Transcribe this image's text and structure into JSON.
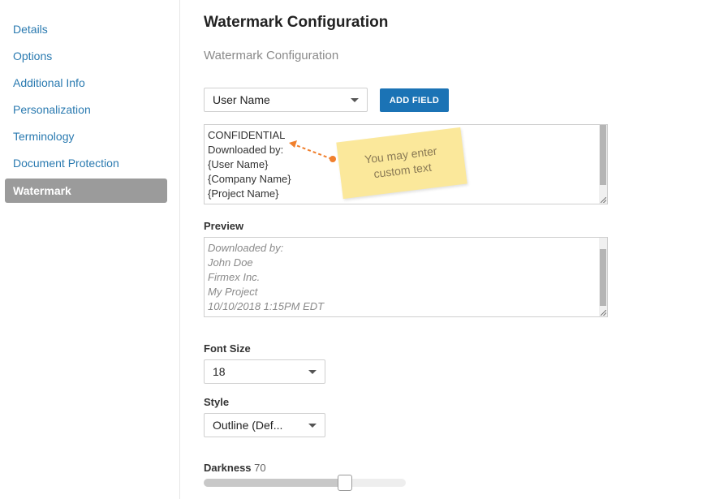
{
  "sidebar": {
    "items": [
      {
        "label": "Details"
      },
      {
        "label": "Options"
      },
      {
        "label": "Additional Info"
      },
      {
        "label": "Personalization"
      },
      {
        "label": "Terminology"
      },
      {
        "label": "Document Protection"
      },
      {
        "label": "Watermark",
        "active": true
      }
    ]
  },
  "main": {
    "title": "Watermark Configuration",
    "subtitle": "Watermark Configuration",
    "field_select": {
      "value": "User Name"
    },
    "add_field_label": "ADD FIELD",
    "watermark_text": {
      "lines": [
        "CONFIDENTIAL",
        "Downloaded by:",
        "{User Name}",
        "{Company Name}",
        "{Project Name}"
      ]
    },
    "annotation": {
      "line1": "You may enter",
      "line2": "custom text"
    },
    "preview": {
      "label": "Preview",
      "lines": [
        "Downloaded by:",
        "John Doe",
        "Firmex Inc.",
        "My Project",
        "10/10/2018 1:15PM EDT"
      ]
    },
    "font_size": {
      "label": "Font Size",
      "value": "18"
    },
    "style": {
      "label": "Style",
      "value": "Outline (Def..."
    },
    "darkness": {
      "label": "Darkness",
      "value": "70",
      "level_percent": 70
    }
  },
  "colors": {
    "link": "#2a7ab0",
    "active_bg": "#9b9b9b",
    "button": "#1b73b5",
    "sticky": "#fbe89b",
    "arrow": "#f07f2d"
  }
}
